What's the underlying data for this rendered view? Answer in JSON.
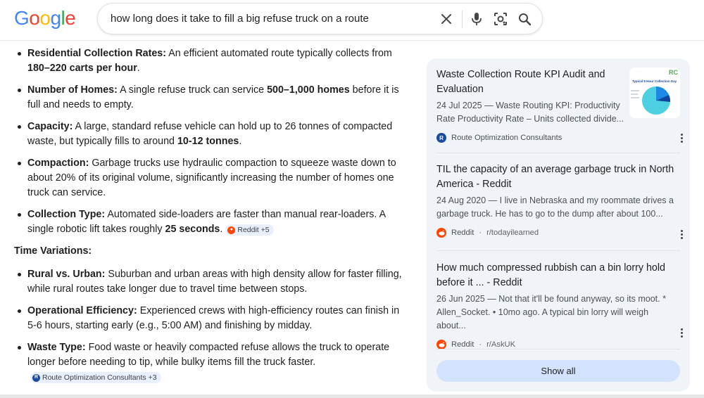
{
  "colors": {
    "accent": "#1a73e8",
    "reddit": "#ff4500",
    "roc": "#1a4aa2",
    "panel_bg": "#f0f4f9",
    "show_all_bg": "#d3e3fd"
  },
  "logo": {
    "letters": [
      "G",
      "o",
      "o",
      "g",
      "l",
      "e"
    ]
  },
  "search": {
    "query": "how long does it take to fill a big refuse truck on a route"
  },
  "icons": {
    "clear": "close-icon",
    "voice": "microphone-icon",
    "lens": "lens-icon",
    "search": "search-icon"
  },
  "main": {
    "bullets_1": [
      {
        "label": "Residential Collection Rates:",
        "pre": " An efficient automated route typically collects from ",
        "bold": "180–220 carts per hour",
        "post": "."
      },
      {
        "label": "Number of Homes:",
        "pre": " A single refuse truck can service ",
        "bold": "500–1,000 homes",
        "post": " before it is full and needs to empty."
      },
      {
        "label": "Capacity:",
        "pre": " A large, standard refuse vehicle can hold up to 26 tonnes of compacted waste, but typically fills to around ",
        "bold": "10-12 tonnes",
        "post": "."
      },
      {
        "label": "Compaction:",
        "pre": " Garbage trucks use hydraulic compaction to squeeze waste down to about 20% of its original volume, significantly increasing the number of homes one truck can service.",
        "bold": "",
        "post": ""
      },
      {
        "label": "Collection Type:",
        "pre": " Automated side-loaders are faster than manual rear-loaders. A single robotic lift takes roughly ",
        "bold": "25 seconds",
        "post": "."
      }
    ],
    "chip_1": "Reddit +5",
    "section_title": "Time Variations:",
    "bullets_2": [
      {
        "label": "Rural vs. Urban:",
        "pre": " Suburban and urban areas with high density allow for faster filling, while rural routes take longer due to travel time between stops.",
        "bold": "",
        "post": ""
      },
      {
        "label": "Operational Efficiency:",
        "pre": " Experienced crews with high-efficiency routes can finish in 5-6 hours, starting early (e.g., 5:00 AM) and finishing by midday.",
        "bold": "",
        "post": ""
      },
      {
        "label": "Waste Type:",
        "pre": " Food waste or heavily compacted refuse allows the truck to operate longer before needing to tip, while bulky items fill the truck faster.",
        "bold": "",
        "post": ""
      }
    ],
    "chip_2": "Route Optimization Consultants +3"
  },
  "panel": {
    "cards": [
      {
        "title": "Waste Collection Route KPI Audit and Evaluation",
        "snippet": "24 Jul 2025 — Waste Routing KPI: Productivity Rate Productivity Rate – Units collected divide...",
        "source": "Route Optimization Consultants",
        "sub": "",
        "icon": "R",
        "thumb_title": "Typical 8 Hour Collection Day",
        "thumb_logo": "RC"
      },
      {
        "title": "TIL the capacity of an average garbage truck in North America - Reddit",
        "snippet": "24 Aug 2020 — I live in Nebraska and my roommate drives a garbage truck. He has to go to the dump after about 100...",
        "source": "Reddit",
        "sub": "r/todayilearned",
        "icon": "reddit-icon"
      },
      {
        "title": "How much compressed rubbish can a bin lorry hold before it ... - Reddit",
        "snippet": "26 Jun 2025 — Not that it'll be found anyway, so its moot. * Allen_Socket. • 10mo ago. A typical bin lorry will weigh about...",
        "source": "Reddit",
        "sub": "r/AskUK",
        "icon": "reddit-icon"
      }
    ],
    "dot_separator": "·",
    "show_all": "Show all"
  }
}
